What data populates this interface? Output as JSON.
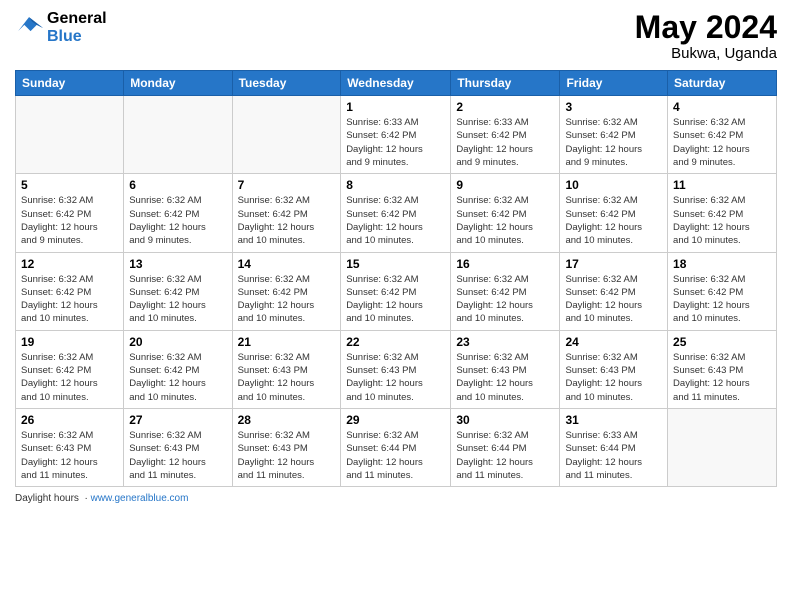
{
  "logo": {
    "line1": "General",
    "line2": "Blue"
  },
  "title": {
    "month_year": "May 2024",
    "location": "Bukwa, Uganda"
  },
  "weekdays": [
    "Sunday",
    "Monday",
    "Tuesday",
    "Wednesday",
    "Thursday",
    "Friday",
    "Saturday"
  ],
  "weeks": [
    [
      {
        "day": "",
        "info": ""
      },
      {
        "day": "",
        "info": ""
      },
      {
        "day": "",
        "info": ""
      },
      {
        "day": "1",
        "info": "Sunrise: 6:33 AM\nSunset: 6:42 PM\nDaylight: 12 hours\nand 9 minutes."
      },
      {
        "day": "2",
        "info": "Sunrise: 6:33 AM\nSunset: 6:42 PM\nDaylight: 12 hours\nand 9 minutes."
      },
      {
        "day": "3",
        "info": "Sunrise: 6:32 AM\nSunset: 6:42 PM\nDaylight: 12 hours\nand 9 minutes."
      },
      {
        "day": "4",
        "info": "Sunrise: 6:32 AM\nSunset: 6:42 PM\nDaylight: 12 hours\nand 9 minutes."
      }
    ],
    [
      {
        "day": "5",
        "info": "Sunrise: 6:32 AM\nSunset: 6:42 PM\nDaylight: 12 hours\nand 9 minutes."
      },
      {
        "day": "6",
        "info": "Sunrise: 6:32 AM\nSunset: 6:42 PM\nDaylight: 12 hours\nand 9 minutes."
      },
      {
        "day": "7",
        "info": "Sunrise: 6:32 AM\nSunset: 6:42 PM\nDaylight: 12 hours\nand 10 minutes."
      },
      {
        "day": "8",
        "info": "Sunrise: 6:32 AM\nSunset: 6:42 PM\nDaylight: 12 hours\nand 10 minutes."
      },
      {
        "day": "9",
        "info": "Sunrise: 6:32 AM\nSunset: 6:42 PM\nDaylight: 12 hours\nand 10 minutes."
      },
      {
        "day": "10",
        "info": "Sunrise: 6:32 AM\nSunset: 6:42 PM\nDaylight: 12 hours\nand 10 minutes."
      },
      {
        "day": "11",
        "info": "Sunrise: 6:32 AM\nSunset: 6:42 PM\nDaylight: 12 hours\nand 10 minutes."
      }
    ],
    [
      {
        "day": "12",
        "info": "Sunrise: 6:32 AM\nSunset: 6:42 PM\nDaylight: 12 hours\nand 10 minutes."
      },
      {
        "day": "13",
        "info": "Sunrise: 6:32 AM\nSunset: 6:42 PM\nDaylight: 12 hours\nand 10 minutes."
      },
      {
        "day": "14",
        "info": "Sunrise: 6:32 AM\nSunset: 6:42 PM\nDaylight: 12 hours\nand 10 minutes."
      },
      {
        "day": "15",
        "info": "Sunrise: 6:32 AM\nSunset: 6:42 PM\nDaylight: 12 hours\nand 10 minutes."
      },
      {
        "day": "16",
        "info": "Sunrise: 6:32 AM\nSunset: 6:42 PM\nDaylight: 12 hours\nand 10 minutes."
      },
      {
        "day": "17",
        "info": "Sunrise: 6:32 AM\nSunset: 6:42 PM\nDaylight: 12 hours\nand 10 minutes."
      },
      {
        "day": "18",
        "info": "Sunrise: 6:32 AM\nSunset: 6:42 PM\nDaylight: 12 hours\nand 10 minutes."
      }
    ],
    [
      {
        "day": "19",
        "info": "Sunrise: 6:32 AM\nSunset: 6:42 PM\nDaylight: 12 hours\nand 10 minutes."
      },
      {
        "day": "20",
        "info": "Sunrise: 6:32 AM\nSunset: 6:42 PM\nDaylight: 12 hours\nand 10 minutes."
      },
      {
        "day": "21",
        "info": "Sunrise: 6:32 AM\nSunset: 6:43 PM\nDaylight: 12 hours\nand 10 minutes."
      },
      {
        "day": "22",
        "info": "Sunrise: 6:32 AM\nSunset: 6:43 PM\nDaylight: 12 hours\nand 10 minutes."
      },
      {
        "day": "23",
        "info": "Sunrise: 6:32 AM\nSunset: 6:43 PM\nDaylight: 12 hours\nand 10 minutes."
      },
      {
        "day": "24",
        "info": "Sunrise: 6:32 AM\nSunset: 6:43 PM\nDaylight: 12 hours\nand 10 minutes."
      },
      {
        "day": "25",
        "info": "Sunrise: 6:32 AM\nSunset: 6:43 PM\nDaylight: 12 hours\nand 11 minutes."
      }
    ],
    [
      {
        "day": "26",
        "info": "Sunrise: 6:32 AM\nSunset: 6:43 PM\nDaylight: 12 hours\nand 11 minutes."
      },
      {
        "day": "27",
        "info": "Sunrise: 6:32 AM\nSunset: 6:43 PM\nDaylight: 12 hours\nand 11 minutes."
      },
      {
        "day": "28",
        "info": "Sunrise: 6:32 AM\nSunset: 6:43 PM\nDaylight: 12 hours\nand 11 minutes."
      },
      {
        "day": "29",
        "info": "Sunrise: 6:32 AM\nSunset: 6:44 PM\nDaylight: 12 hours\nand 11 minutes."
      },
      {
        "day": "30",
        "info": "Sunrise: 6:32 AM\nSunset: 6:44 PM\nDaylight: 12 hours\nand 11 minutes."
      },
      {
        "day": "31",
        "info": "Sunrise: 6:33 AM\nSunset: 6:44 PM\nDaylight: 12 hours\nand 11 minutes."
      },
      {
        "day": "",
        "info": ""
      }
    ]
  ],
  "footer": {
    "text": "Daylight hours",
    "url_label": "www.generalblue.com"
  }
}
